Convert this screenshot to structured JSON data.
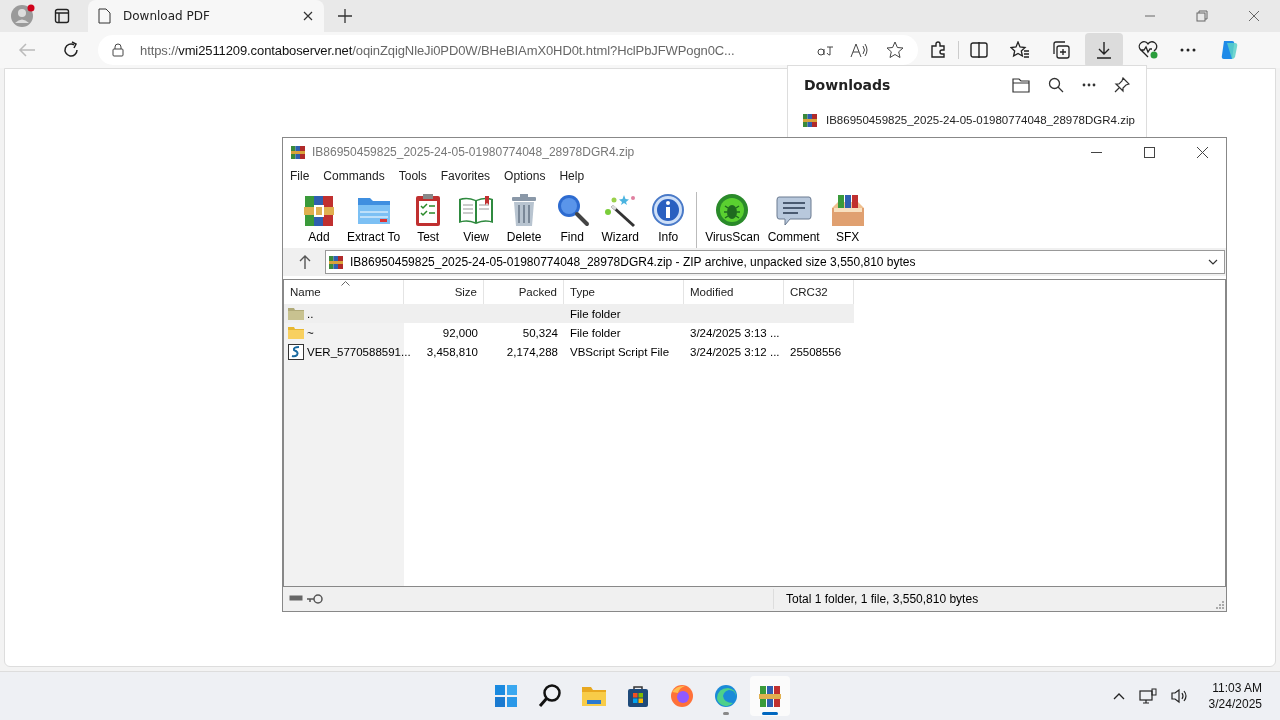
{
  "browser": {
    "tab_title": "Download PDF",
    "url_scheme": "https://",
    "url_host": "vmi2511209.contaboserver.net",
    "url_path": "/oqinZqigNleJi0PD0W/BHeBIAmX0HD0t.html?HclPbJFWPogn0C...",
    "downloads_open": true
  },
  "downloads": {
    "title": "Downloads",
    "items": [
      {
        "name": "IB86950459825_2025-24-05-01980774048_28978DGR4.zip"
      }
    ]
  },
  "winrar": {
    "title": "IB86950459825_2025-24-05-01980774048_28978DGR4.zip",
    "menu": [
      "File",
      "Commands",
      "Tools",
      "Favorites",
      "Options",
      "Help"
    ],
    "toolbar": [
      {
        "kind": "add",
        "label": "Add",
        "separator": false
      },
      {
        "kind": "extract",
        "label": "Extract To",
        "separator": false
      },
      {
        "kind": "test",
        "label": "Test",
        "separator": false
      },
      {
        "kind": "view",
        "label": "View",
        "separator": false
      },
      {
        "kind": "delete",
        "label": "Delete",
        "separator": false
      },
      {
        "kind": "find",
        "label": "Find",
        "separator": false
      },
      {
        "kind": "wizard",
        "label": "Wizard",
        "separator": false
      },
      {
        "kind": "info",
        "label": "Info",
        "separator": false
      },
      {
        "kind": "virusscan",
        "label": "VirusScan",
        "separator": true
      },
      {
        "kind": "comment",
        "label": "Comment",
        "separator": false
      },
      {
        "kind": "sfx",
        "label": "SFX",
        "separator": false
      }
    ],
    "path": "IB86950459825_2025-24-05-01980774048_28978DGR4.zip - ZIP archive, unpacked size 3,550,810 bytes",
    "columns": [
      "Name",
      "Size",
      "Packed",
      "Type",
      "Modified",
      "CRC32"
    ],
    "rows": [
      {
        "kind": "up",
        "selected": true,
        "cells": [
          "..",
          "",
          "",
          "File folder",
          "",
          ""
        ]
      },
      {
        "kind": "folder",
        "selected": false,
        "cells": [
          "~",
          "92,000",
          "50,324",
          "File folder",
          "3/24/2025 3:13 ...",
          ""
        ]
      },
      {
        "kind": "script",
        "selected": false,
        "cells": [
          "VER_5770588591...",
          "3,458,810",
          "2,174,288",
          "VBScript Script File",
          "3/24/2025 3:12 ...",
          "25508556"
        ]
      }
    ],
    "status": "Total 1 folder, 1 file, 3,550,810 bytes"
  },
  "taskbar": {
    "apps": [
      {
        "kind": "start",
        "open": false,
        "active": false
      },
      {
        "kind": "search",
        "open": false,
        "active": false
      },
      {
        "kind": "files",
        "open": false,
        "active": false
      },
      {
        "kind": "store",
        "open": false,
        "active": false
      },
      {
        "kind": "firefox",
        "open": false,
        "active": false
      },
      {
        "kind": "edge",
        "open": true,
        "active": false
      },
      {
        "kind": "winrar",
        "open": true,
        "active": true
      }
    ],
    "time": "11:03 AM",
    "date": "3/24/2025"
  }
}
